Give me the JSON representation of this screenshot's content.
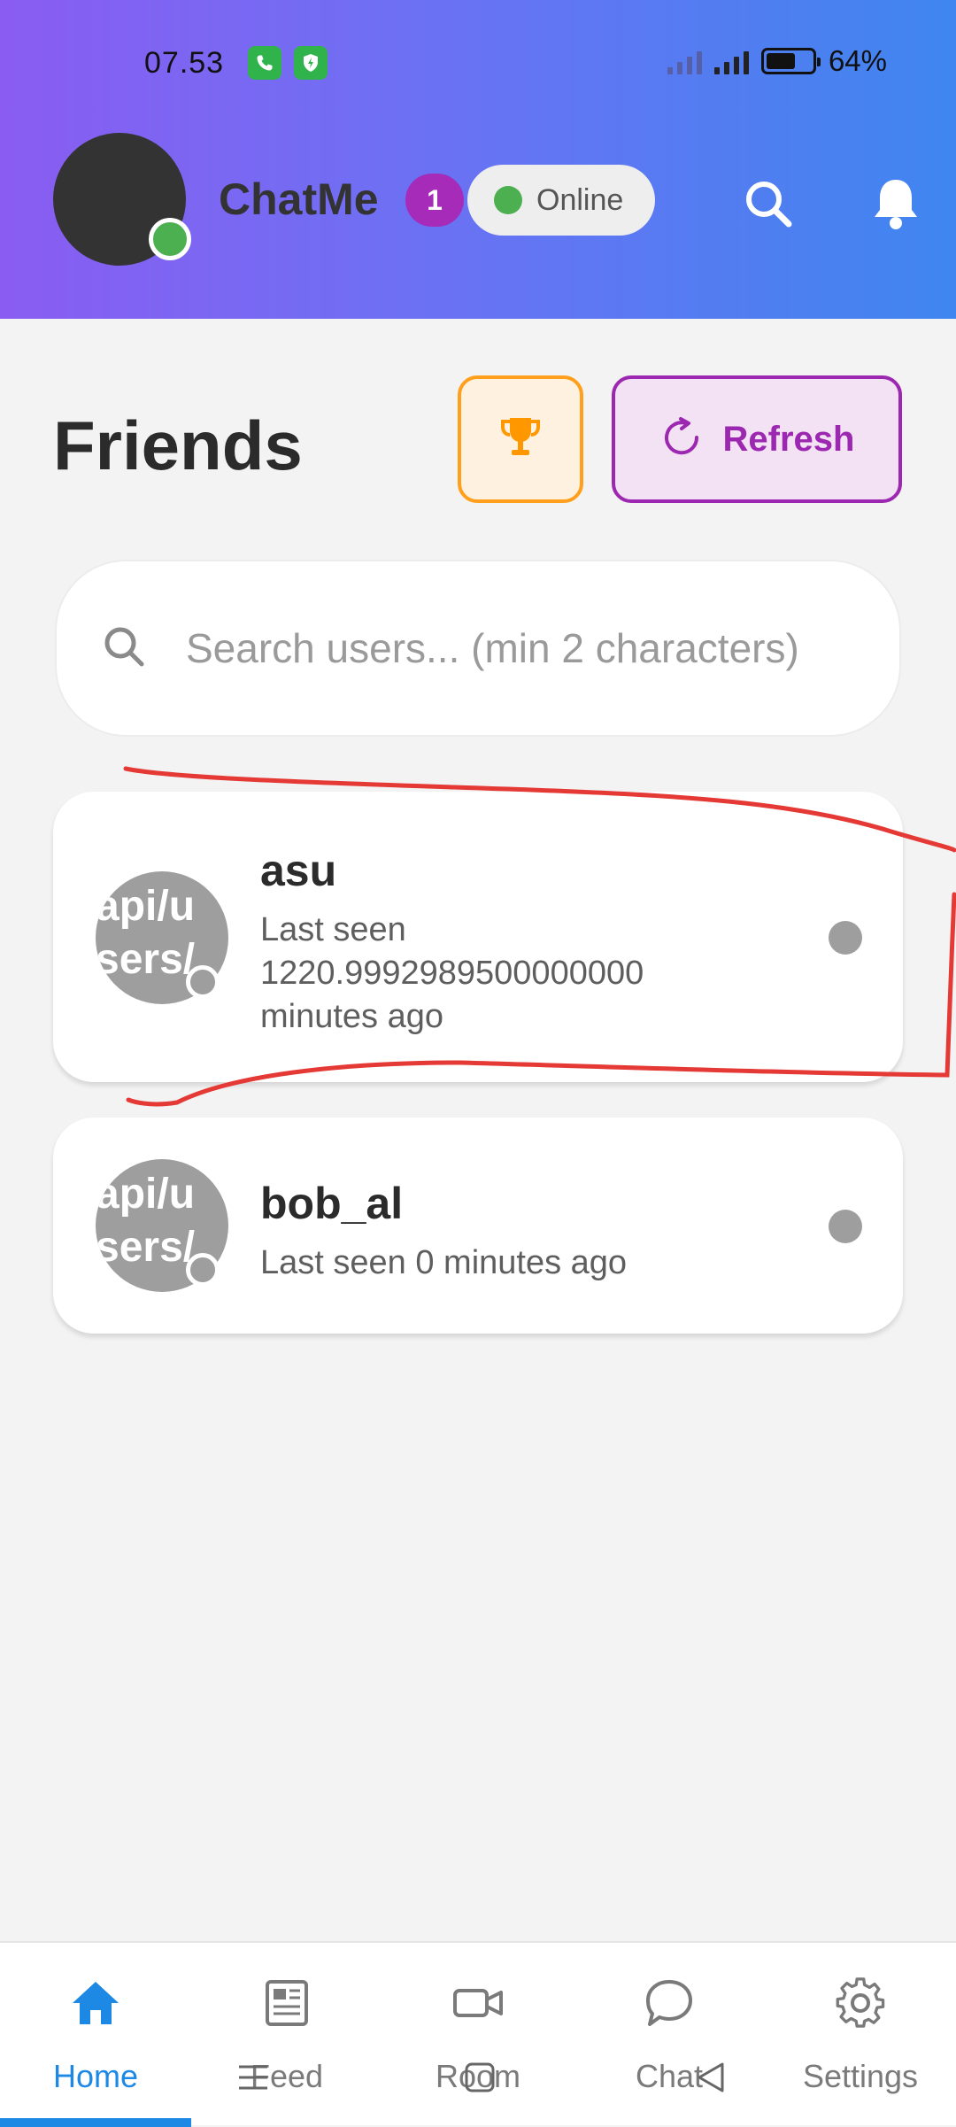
{
  "status_bar": {
    "time": "07.53",
    "battery_percent": "64%",
    "battery_level": 0.64
  },
  "header": {
    "app_name": "ChatMe",
    "notification_count": "1",
    "status_label": "Online",
    "avatar_status_color": "#4caf50"
  },
  "friends": {
    "title": "Friends",
    "refresh_label": "Refresh"
  },
  "search": {
    "placeholder": "Search users... (min 2 characters)"
  },
  "friend_list": [
    {
      "avatar_text": "api/u\nsers/",
      "name": "asu",
      "last_seen": "Last seen 1220.9992989500000000 minutes ago"
    },
    {
      "avatar_text": "api/u\nsers/",
      "name": "bob_al",
      "last_seen": "Last seen 0 minutes ago"
    }
  ],
  "nav": {
    "items": [
      {
        "label": "Home",
        "icon": "home-icon",
        "active": true
      },
      {
        "label": "Feed",
        "icon": "feed-icon",
        "active": false
      },
      {
        "label": "Room",
        "icon": "video-icon",
        "active": false
      },
      {
        "label": "Chat",
        "icon": "chat-icon",
        "active": false
      },
      {
        "label": "Settings",
        "icon": "gear-icon",
        "active": false
      }
    ]
  },
  "colors": {
    "accent_purple": "#9c27b0",
    "accent_orange": "#ff9f1c",
    "nav_active": "#1e88e5",
    "online_green": "#4caf50",
    "annotation_red": "#e53935"
  }
}
